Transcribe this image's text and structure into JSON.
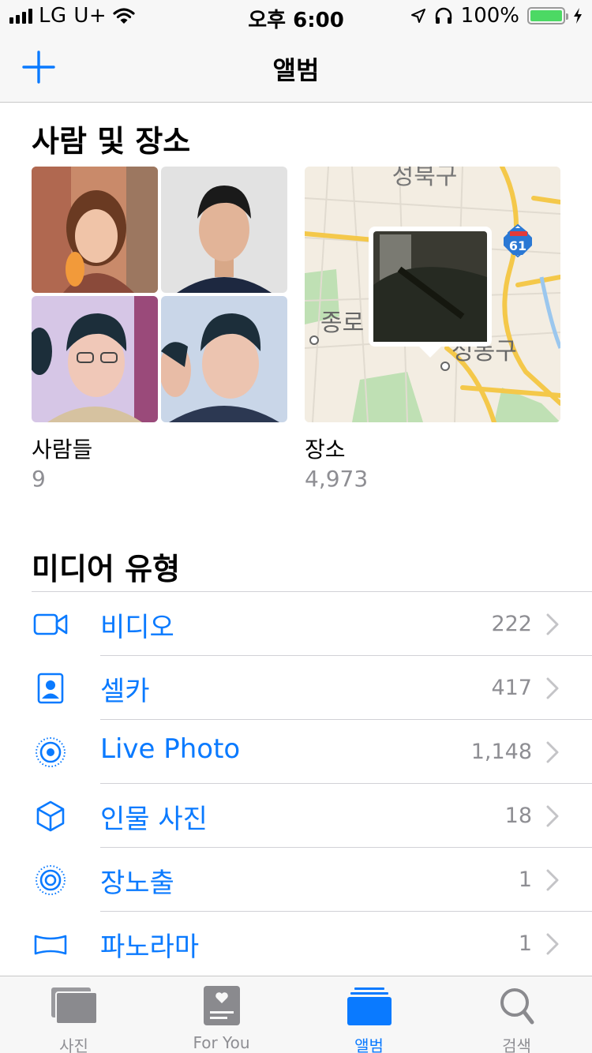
{
  "status_bar": {
    "carrier": "LG U+",
    "time": "오후 6:00",
    "battery_percent": "100%",
    "battery_level": 1.0,
    "battery_color": "#4cd964",
    "icons": [
      "signal-icon",
      "wifi-icon",
      "location-arrow-icon",
      "headphones-icon",
      "battery-icon",
      "charging-bolt-icon"
    ]
  },
  "nav": {
    "title": "앨범",
    "add_icon": "plus-icon"
  },
  "people_places": {
    "section_title": "사람 및 장소",
    "people": {
      "label": "사람들",
      "count": "9"
    },
    "places": {
      "label": "장소",
      "count": "4,973",
      "map_labels": [
        "성북구",
        "종로",
        "성동구",
        "61"
      ]
    }
  },
  "media_types": {
    "section_title": "미디어 유형",
    "items": [
      {
        "label": "비디오",
        "count": "222",
        "icon": "video-camera-icon"
      },
      {
        "label": "셀카",
        "count": "417",
        "icon": "selfie-portrait-icon"
      },
      {
        "label": "Live Photo",
        "count": "1,148",
        "icon": "live-photo-icon"
      },
      {
        "label": "인물 사진",
        "count": "18",
        "icon": "portrait-cube-icon"
      },
      {
        "label": "장노출",
        "count": "1",
        "icon": "long-exposure-icon"
      },
      {
        "label": "파노라마",
        "count": "1",
        "icon": "panorama-icon"
      }
    ]
  },
  "tab_bar": {
    "tabs": [
      {
        "label": "사진",
        "icon": "photos-tab-icon",
        "active": false
      },
      {
        "label": "For You",
        "icon": "for-you-tab-icon",
        "active": false
      },
      {
        "label": "앨범",
        "icon": "albums-tab-icon",
        "active": true
      },
      {
        "label": "검색",
        "icon": "search-tab-icon",
        "active": false
      }
    ]
  },
  "colors": {
    "accent": "#0a7aff",
    "secondary_text": "#8e8e93",
    "bar_background": "#f7f7f7"
  }
}
